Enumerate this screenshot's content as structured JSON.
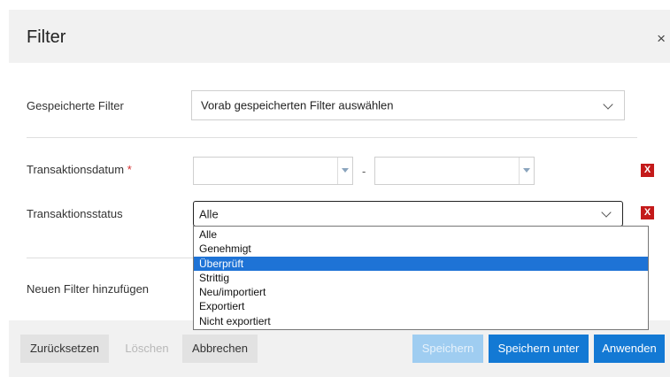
{
  "header": {
    "title": "Filter",
    "close_icon": "×"
  },
  "saved_filter": {
    "label": "Gespeicherte Filter",
    "value": "Vorab gespeicherten Filter auswählen"
  },
  "date": {
    "label": "Transaktionsdatum",
    "required_mark": "*",
    "from_value": "",
    "separator": "-",
    "to_value": "",
    "remove_label": "X"
  },
  "status": {
    "label": "Transaktionsstatus",
    "value": "Alle",
    "remove_label": "X",
    "options": [
      "Alle",
      "Genehmigt",
      "Überprüft",
      "Strittig",
      "Neu/importiert",
      "Exportiert",
      "Nicht exportiert"
    ],
    "highlighted_option": "Überprüft"
  },
  "add_filter": {
    "label": "Neuen Filter hinzufügen"
  },
  "footer": {
    "reset": "Zurücksetzen",
    "delete": "Löschen",
    "cancel": "Abbrechen",
    "save": "Speichern",
    "save_as": "Speichern unter",
    "apply": "Anwenden"
  },
  "colors": {
    "primary": "#1379d4",
    "primary_disabled": "#9fcdf1",
    "danger": "#c41a1a",
    "highlight": "#1e73d6"
  }
}
